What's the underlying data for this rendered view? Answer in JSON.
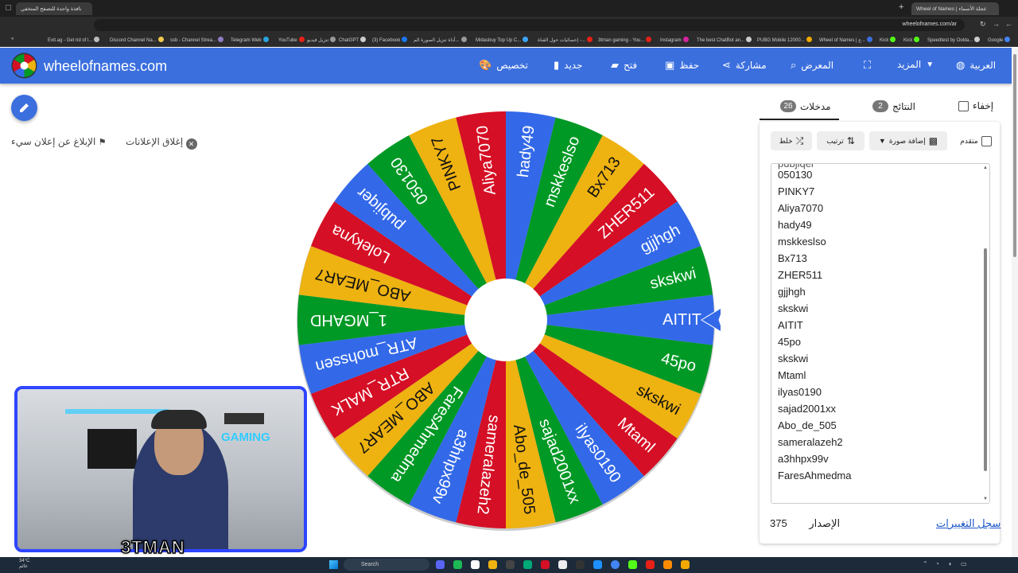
{
  "browser": {
    "tabs": [
      {
        "label": "نافذة واحدة للتصفح المتخفي"
      },
      {
        "label": "Wheel of Names | عجلة الأسماء"
      }
    ],
    "url": "wheelofnames.com/ar",
    "bookmarks": [
      "Exit.ag - Get rid of l...",
      "Discord Channel Na...",
      "ssb - Channel Strea...",
      "Telegram Web",
      "YouTube",
      "تنزيل فيديو",
      "ChatGPT",
      "(3) Facebook",
      "أداة تنزيل الصورة الم...",
      "Midasbuy Top Up C...",
      "إحصائيات حول القناة -...",
      "3tman gaming - You...",
      "Instagram",
      "The best ChatBot an...",
      "PUBG Mobile 12000...",
      "Wheel of Names | ع...",
      "Kick",
      "Kick",
      "Speedtest by Ookla...",
      "Google"
    ]
  },
  "app": {
    "brand": "wheelofnames.com",
    "menu": {
      "customize": "تخصيص",
      "new": "جديد",
      "open": "فتح",
      "save": "حفظ",
      "share": "مشاركة",
      "gallery": "المعرض",
      "more": "المزيد",
      "language": "العربية"
    }
  },
  "left": {
    "close_ads": "إغلاق الإعلانات",
    "report_ad": "الإبلاغ عن إعلان سيء"
  },
  "webcam": {
    "overlay_name": "3TMAN",
    "wall_sign": "GAMING"
  },
  "wheel": {
    "colors": [
      "#3369e8",
      "#009925",
      "#eeb211",
      "#d50f25"
    ],
    "segments": [
      "AITIT",
      "45po",
      "skskwi",
      "Mtaml",
      "ilyas0190",
      "sajad2001xx",
      "Abo_de_505",
      "sameralazeh2",
      "a3hhpx99v",
      "FaresAhmedma",
      "ABO_MEAR7",
      "RTR_MALK",
      "ATR_mohssen",
      "1_MGAHD",
      "ABO_MEAR7",
      "Lolekyna",
      "pubjiqer",
      "050130",
      "PINKY7",
      "Aliya7070",
      "hady49",
      "mskkeslso",
      "Bx713",
      "ZHER511",
      "gjjhgh",
      "skskwi"
    ]
  },
  "panel": {
    "tabs": {
      "entries_label": "مدخلات",
      "entries_count": "26",
      "results_label": "النتائج",
      "results_count": "2",
      "hide_label": "إخفاء"
    },
    "toolbar": {
      "shuffle": "خلط",
      "sort": "ترتيب",
      "add_image": "إضافة صورة",
      "advanced": "متقدم"
    },
    "entries": [
      "050130",
      "PINKY7",
      "Aliya7070",
      "hady49",
      "mskkeslso",
      "Bx713",
      "ZHER511",
      "gjjhgh",
      "skskwi",
      "AITIT",
      "45po",
      "skskwi",
      "Mtaml",
      "ilyas0190",
      "sajad2001xx",
      "Abo_de_505",
      "sameralazeh2",
      "a3hhpx99v",
      "FaresAhmedma"
    ],
    "version_label": "الإصدار",
    "version_number": "375",
    "changelog": "سجل التغييرات"
  },
  "taskbar": {
    "weather_temp": "34°C",
    "weather_desc": "غائم",
    "search": "Search"
  },
  "accent": "#3b6fde"
}
